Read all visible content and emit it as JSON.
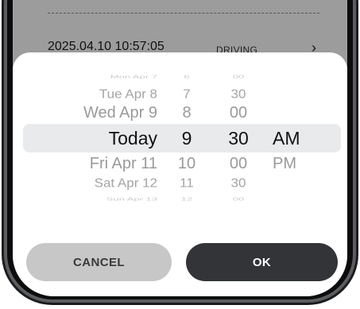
{
  "header": {
    "trip_datetime": "2025.04.10 10:57:05",
    "trip_status": "DRIVING",
    "chevron": "›"
  },
  "picker": {
    "days": [
      "Mon Apr 7",
      "Tue Apr 8",
      "Wed Apr 9",
      "Today",
      "Fri Apr 11",
      "Sat Apr 12",
      "Sun Apr 13"
    ],
    "hours": [
      "6",
      "7",
      "8",
      "9",
      "10",
      "11",
      "12"
    ],
    "minutes": [
      "00",
      "30",
      "00",
      "30",
      "00",
      "30",
      "00"
    ],
    "ampm": [
      "AM",
      "PM"
    ],
    "selected": {
      "day": "Today",
      "hour": "9",
      "minute": "30",
      "period": "AM"
    }
  },
  "buttons": {
    "cancel_label": "CANCEL",
    "ok_label": "OK"
  },
  "icons": {
    "chevron": "chevron-right-icon"
  },
  "colors": {
    "ok_button_bg": "#323437",
    "cancel_button_bg": "#c7c7c7",
    "selection_band": "#e9eaec",
    "dimmed_background": "#9c9c9c"
  }
}
